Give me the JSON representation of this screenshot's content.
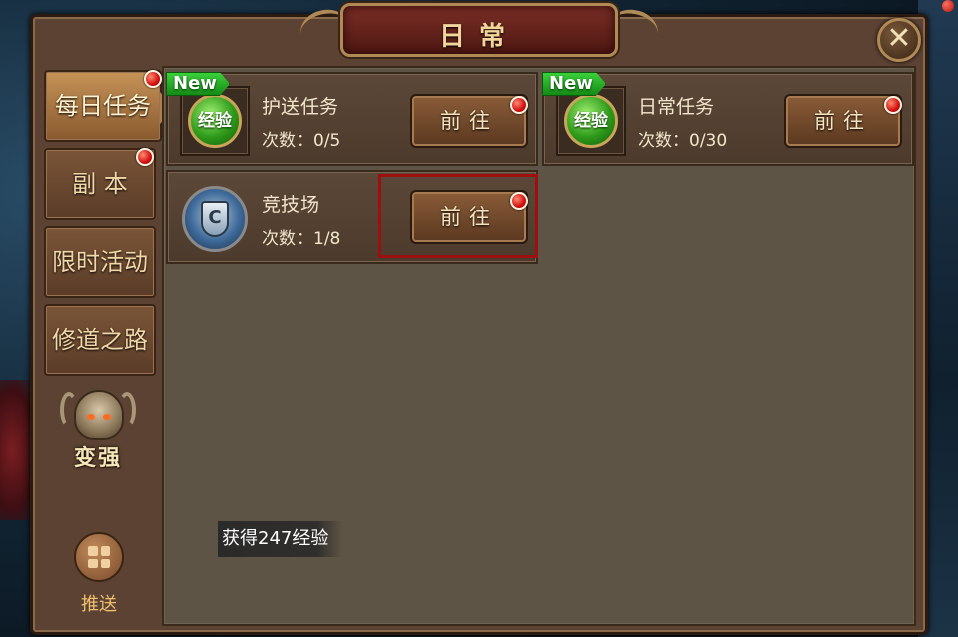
{
  "window": {
    "title": "日常",
    "close_label": "✕"
  },
  "sidebar": {
    "tabs": [
      {
        "label": "每日任务",
        "active": true,
        "has_alert": true
      },
      {
        "label": "副 本",
        "active": false,
        "has_alert": true
      },
      {
        "label": "限时活动",
        "active": false,
        "has_alert": false
      },
      {
        "label": "修道之路",
        "active": false,
        "has_alert": false
      }
    ],
    "strong_label": "变强",
    "push_label": "推送"
  },
  "tasks": [
    {
      "name": "护送任务",
      "count": "次数：0/5",
      "badge": "New",
      "icon_text": "经验",
      "icon": "exp-orb-icon",
      "button": "前往",
      "has_alert": true
    },
    {
      "name": "日常任务",
      "count": "次数：0/30",
      "badge": "New",
      "icon_text": "经验",
      "icon": "exp-orb-icon",
      "button": "前往",
      "has_alert": true
    },
    {
      "name": "竞技场",
      "count": "次数：1/8",
      "badge": "",
      "icon_text": "",
      "icon": "arena-shield-icon",
      "button": "前往",
      "has_alert": true,
      "highlighted": true
    }
  ],
  "toast": "获得247经验",
  "colors": {
    "panel": "#5b4232",
    "content": "#5e5445",
    "title_plate": "#7a2e26",
    "alert_dot": "#d21010",
    "new_tag": "#2aa82a",
    "highlight": "#9e1010"
  }
}
